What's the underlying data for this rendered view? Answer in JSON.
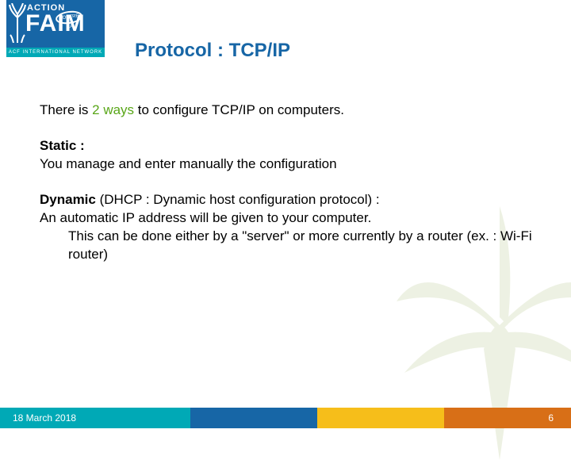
{
  "logo": {
    "topword": "ACTION",
    "circle_text": "CONTRE LA",
    "mainword": "FAIM",
    "band": "ACF INTERNATIONAL NETWORK"
  },
  "slide": {
    "title": "Protocol : TCP/IP",
    "intro_pre": "There is ",
    "intro_hl": "2 ways",
    "intro_post": " to configure TCP/IP on computers.",
    "static_label": "Static :",
    "static_body": "You manage and enter manually the configuration",
    "dynamic_label": "Dynamic",
    "dynamic_paren": " (DHCP : Dynamic host configuration protocol) :",
    "dynamic_body_line1": "An automatic IP address will be given to your computer.",
    "dynamic_body_line2": "This can be done either by a \"server\" or more currently by a router (ex. : Wi-Fi router)"
  },
  "footer": {
    "date": "18 March 2018",
    "page": "6"
  }
}
